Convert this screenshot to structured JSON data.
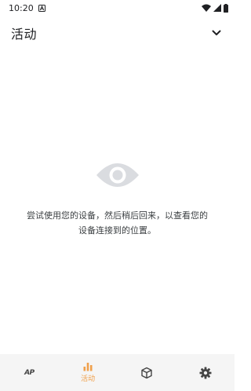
{
  "status_bar": {
    "time": "10:20",
    "icons": [
      "notification-a-icon",
      "wifi-icon",
      "cellular-icon",
      "battery-icon"
    ]
  },
  "app_bar": {
    "title": "活动",
    "menu_icon": "chevron-down-icon"
  },
  "empty_state": {
    "icon": "eye-icon",
    "message": "尝试使用您的设备，然后稍后回来，以查看您的设备连接到的位置。"
  },
  "bottom_nav": {
    "items": [
      {
        "icon": "ap-icon",
        "glyph": "AP",
        "label": "",
        "active": false
      },
      {
        "icon": "bar-chart-icon",
        "label": "活动",
        "active": true
      },
      {
        "icon": "cube-icon",
        "label": "",
        "active": false
      },
      {
        "icon": "gear-icon",
        "label": "",
        "active": false
      }
    ],
    "active_color": "#f0a04b"
  },
  "colors": {
    "background": "#ffffff",
    "nav_background": "#f5f5f5",
    "accent": "#f0a04b",
    "eye_icon": "#dadce0"
  }
}
